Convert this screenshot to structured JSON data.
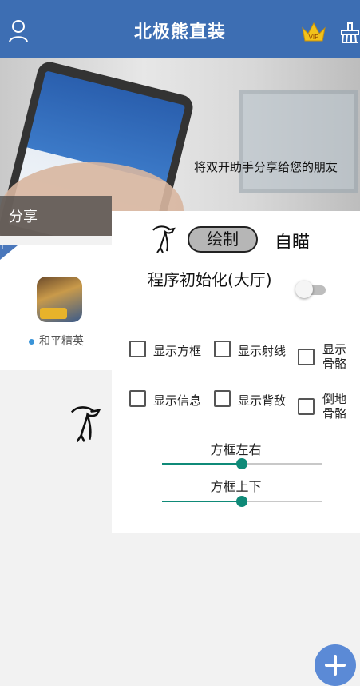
{
  "header": {
    "title": "北极熊直装",
    "vip_label": "VIP",
    "icons": [
      "user-icon",
      "vip-crown-icon",
      "clean-icon"
    ]
  },
  "banner": {
    "slogan": "将双开助手分享给您的朋友",
    "share_label": "分享"
  },
  "app_list": {
    "badge_count": "1",
    "items": [
      {
        "name": "和平精英",
        "status_color": "#3a94d8"
      }
    ]
  },
  "panel": {
    "draw_button": "绘制",
    "aim_label": "自瞄",
    "init_label": "程序初始化(大厅)",
    "init_toggle": false,
    "checkboxes": [
      {
        "label": "显示方框",
        "checked": false
      },
      {
        "label": "显示射线",
        "checked": false
      },
      {
        "label": "显示骨骼",
        "checked": false
      },
      {
        "label": "显示信息",
        "checked": false
      },
      {
        "label": "显示背敌",
        "checked": false
      },
      {
        "label": "倒地骨骼",
        "checked": false
      }
    ],
    "sliders": [
      {
        "label": "方框左右",
        "value": 0.5
      },
      {
        "label": "方框上下",
        "value": 0.5
      }
    ]
  },
  "colors": {
    "header_bg": "#3d6eb3",
    "accent": "#0f8a78",
    "fab": "#5b8ad6"
  }
}
